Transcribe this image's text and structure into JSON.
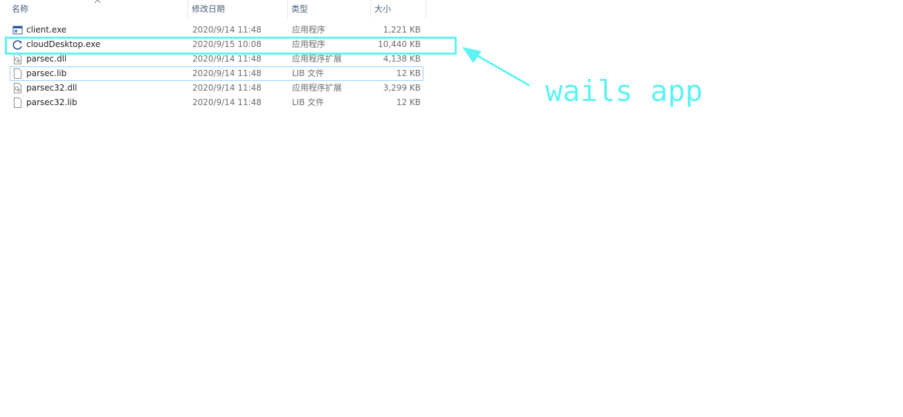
{
  "columns": {
    "name": "名称",
    "date": "修改日期",
    "type": "类型",
    "size": "大小"
  },
  "files": [
    {
      "name": "client.exe",
      "date": "2020/9/14 11:48",
      "type": "应用程序",
      "size": "1,221 KB",
      "icon": "app-window-icon"
    },
    {
      "name": "cloudDesktop.exe",
      "date": "2020/9/15 10:08",
      "type": "应用程序",
      "size": "10,440 KB",
      "icon": "cloud-app-icon"
    },
    {
      "name": "parsec.dll",
      "date": "2020/9/14 11:48",
      "type": "应用程序扩展",
      "size": "4,138 KB",
      "icon": "dll-file-icon"
    },
    {
      "name": "parsec.lib",
      "date": "2020/9/14 11:48",
      "type": "LIB 文件",
      "size": "12 KB",
      "icon": "blank-file-icon"
    },
    {
      "name": "parsec32.dll",
      "date": "2020/9/14 11:48",
      "type": "应用程序扩展",
      "size": "3,299 KB",
      "icon": "dll-file-icon"
    },
    {
      "name": "parsec32.lib",
      "date": "2020/9/14 11:48",
      "type": "LIB 文件",
      "size": "12 KB",
      "icon": "blank-file-icon"
    }
  ],
  "annotation": {
    "label": "wails app",
    "color": "#5ef3f3"
  },
  "colors": {
    "header_text": "#4c607a",
    "focus_border": "#99d1ff",
    "secondary_text": "#6d6d6d"
  }
}
